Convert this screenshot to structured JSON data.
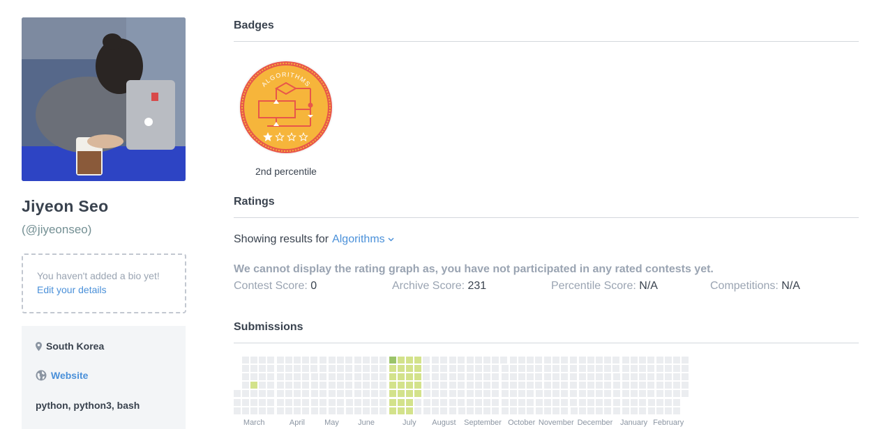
{
  "profile": {
    "name": "Jiyeon Seo",
    "handle": "(@jiyeonseo)",
    "bio_empty": "You haven't added a bio yet!",
    "bio_edit": "Edit your details",
    "location": "South Korea",
    "website": "Website",
    "languages": "python, python3, bash"
  },
  "badges": {
    "title": "Badges",
    "items": [
      {
        "name": "ALGORITHMS",
        "label": "2nd percentile",
        "stars_filled": 1,
        "stars_total": 4,
        "color": "#f6b53b"
      }
    ]
  },
  "ratings": {
    "title": "Ratings",
    "showing_prefix": "Showing results for",
    "track": "Algorithms",
    "no_graph": "We cannot display the rating graph as, you have not participated in any rated contests yet.",
    "scores": [
      {
        "label": "Contest Score:",
        "value": "0"
      },
      {
        "label": "Archive Score:",
        "value": "231"
      },
      {
        "label": "Percentile Score:",
        "value": "N/A"
      },
      {
        "label": "Competitions:",
        "value": "N/A"
      }
    ]
  },
  "submissions": {
    "title": "Submissions",
    "colors": {
      "empty": "#ebedf0",
      "light": "#d3e28b",
      "dark": "#9bc46a"
    },
    "months": [
      "March",
      "April",
      "May",
      "June",
      "July",
      "August",
      "September",
      "October",
      "November",
      "December",
      "January",
      "February"
    ]
  }
}
